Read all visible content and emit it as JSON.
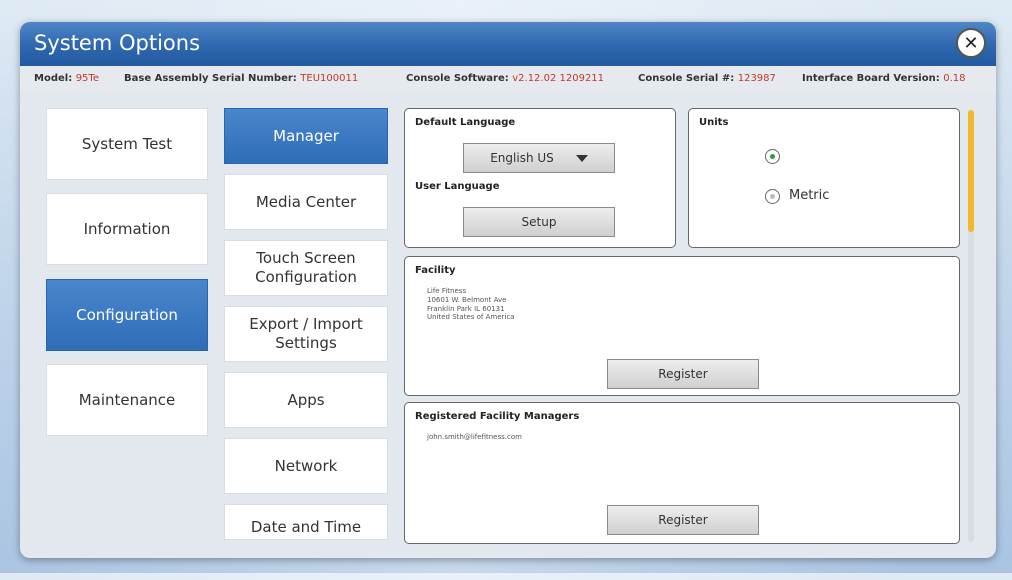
{
  "window": {
    "title": "System Options"
  },
  "info": {
    "model_label": "Model:",
    "model_value": "95Te",
    "base_label": "Base Assembly Serial Number:",
    "base_value": "TEU100011",
    "software_label": "Console Software:",
    "software_value": "v2.12.02 1209211",
    "console_serial_label": "Console Serial #:",
    "console_serial_value": "123987",
    "interface_label": "Interface Board Version:",
    "interface_value": "0.18"
  },
  "categories": [
    "System Test",
    "Information",
    "Configuration",
    "Maintenance"
  ],
  "subcategories": [
    "Manager",
    "Media Center",
    "Touch Screen Configuration",
    "Export / Import Settings",
    "Apps",
    "Network",
    "Date and Time"
  ],
  "language": {
    "default_label": "Default Language",
    "selected": "English US",
    "user_label": "User Language",
    "setup_label": "Setup"
  },
  "units": {
    "label": "Units",
    "option_selected": "",
    "option_metric": "Metric"
  },
  "facility": {
    "label": "Facility",
    "address": [
      "Life Fitness",
      "10601 W. Belmont Ave",
      "Franklin Park IL 60131",
      "United States of America"
    ],
    "register_label": "Register"
  },
  "managers": {
    "label": "Registered Facility Managers",
    "email": "john.smith@lifefitness.com",
    "register_label": "Register"
  },
  "colors": {
    "accent": "#2f6db8",
    "highlight": "#c0392b",
    "scroll_thumb": "#f0b82b"
  },
  "icons": {
    "close": "close-icon",
    "dropdown": "chevron-down-icon"
  }
}
